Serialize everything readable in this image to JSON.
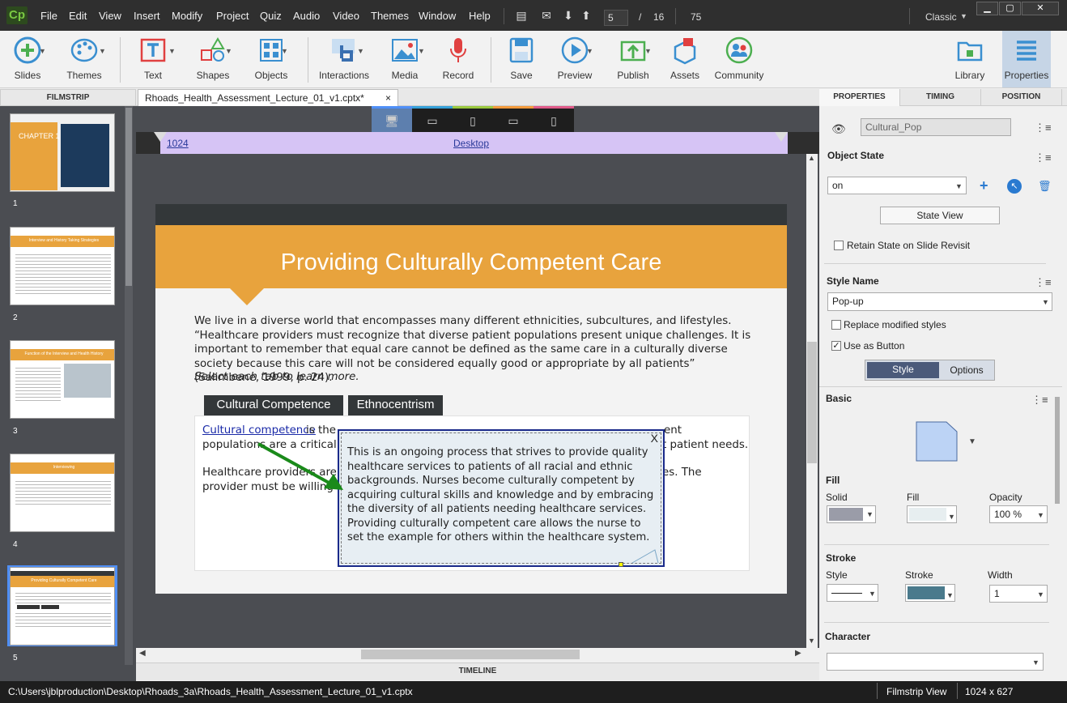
{
  "menubar": {
    "logo": "Cp",
    "items": [
      "File",
      "Edit",
      "View",
      "Insert",
      "Modify",
      "Project",
      "Quiz",
      "Audio",
      "Video",
      "Themes",
      "Window",
      "Help"
    ],
    "current_slide": "5",
    "slide_sep": "/",
    "total_slides": "16",
    "zoom": "75",
    "workspace": "Classic",
    "win_min": "▁",
    "win_max": "▢",
    "win_close": "✕"
  },
  "toolbar": {
    "slides": "Slides",
    "themes": "Themes",
    "text": "Text",
    "shapes": "Shapes",
    "objects": "Objects",
    "interactions": "Interactions",
    "media": "Media",
    "record": "Record",
    "save": "Save",
    "preview": "Preview",
    "publish": "Publish",
    "assets": "Assets",
    "community": "Community",
    "library": "Library",
    "properties": "Properties"
  },
  "filmstrip": {
    "header": "FILMSTRIP",
    "slides": [
      {
        "num": "1",
        "title": "CHAPTER 1"
      },
      {
        "num": "2",
        "title": "Interview and History Taking Strategies"
      },
      {
        "num": "3",
        "title": "Function of the Interview and Health History"
      },
      {
        "num": "4",
        "title": "Interviewing"
      },
      {
        "num": "5",
        "title": "Providing Culturally Competent Care"
      }
    ]
  },
  "document": {
    "tab_label": "Rhoads_Health_Assessment_Lecture_01_v1.cptx*",
    "tab_close": "×",
    "ruler_width": "1024",
    "ruler_label": "Desktop",
    "timeline_label": "TIMELINE"
  },
  "slide": {
    "title": "Providing Culturally Competent Care",
    "body": "We live in a diverse world that encompasses many different ethnicities, subcultures, and lifestyles. “Healthcare providers must recognize that diverse patient populations present unique challenges. It is important to remember that equal care cannot be defined as the same care in a culturally diverse society because this care will not be considered equally good or appropriate by all patients” (Salimbene, 1999, p. 24).",
    "instruction": "Select each tab to learn more.",
    "tab1": "Cultural Competence",
    "tab2": "Ethnocentrism",
    "link": "Cultural competence",
    "line1_after_link": " is the",
    "line1_tail": "ent",
    "line2_head": "populations are a critical pa",
    "line2_tail": "t patient needs.",
    "line3_head": "Healthcare providers are re",
    "line3_tail": "es. The",
    "line4_head": "provider must be willing",
    "popup_close": "X",
    "popup_text": "This is an ongoing process that strives to provide quality healthcare services to patients of all racial and ethnic backgrounds. Nurses become culturally competent by acquiring cultural skills and knowledge and by embracing the diversity of all patients needing healthcare services. Providing culturally competent care allows the nurse to set the example for others within the healthcare system."
  },
  "properties": {
    "tabs": [
      "PROPERTIES",
      "TIMING",
      "POSITION"
    ],
    "object_name": "Cultural_Pop",
    "object_state_label": "Object State",
    "state_value": "on",
    "state_view_btn": "State View",
    "retain_state": "Retain State on Slide Revisit",
    "style_name_label": "Style Name",
    "style_name_value": "Pop-up",
    "replace_styles": "Replace modified styles",
    "use_as_button": "Use as Button",
    "style_tab": "Style",
    "options_tab": "Options",
    "basic_label": "Basic",
    "fill_label": "Fill",
    "fill_solid": "Solid",
    "fill_fill": "Fill",
    "fill_opacity": "Opacity",
    "opacity_value": "100 %",
    "stroke_label": "Stroke",
    "stroke_style": "Style",
    "stroke_stroke": "Stroke",
    "stroke_width": "Width",
    "width_value": "1",
    "character_label": "Character",
    "colors": {
      "fill_solid": "#9a9ca8",
      "fill_color": "#e7eef0",
      "stroke_color": "#4a7a8c",
      "shape_fill": "#bcd3f5"
    }
  },
  "status": {
    "path": "C:\\Users\\jblproduction\\Desktop\\Rhoads_3a\\Rhoads_Health_Assessment_Lecture_01_v1.cptx",
    "view": "Filmstrip View",
    "size": "1024 x 627"
  }
}
